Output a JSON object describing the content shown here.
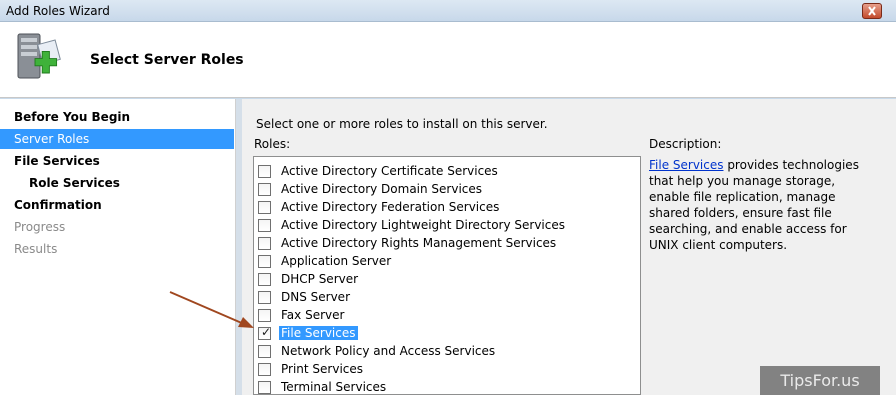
{
  "window": {
    "title": "Add Roles Wizard"
  },
  "header": {
    "title": "Select Server Roles",
    "icon": "server-add-icon"
  },
  "nav": {
    "items": [
      {
        "label": "Before You Begin",
        "state": "normal"
      },
      {
        "label": "Server Roles",
        "state": "selected"
      },
      {
        "label": "File Services",
        "state": "normal"
      },
      {
        "label": "Role Services",
        "state": "sub"
      },
      {
        "label": "Confirmation",
        "state": "normal"
      },
      {
        "label": "Progress",
        "state": "disabled"
      },
      {
        "label": "Results",
        "state": "disabled"
      }
    ]
  },
  "main": {
    "instruction": "Select one or more roles to install on this server.",
    "roles_label": "Roles:",
    "roles": [
      {
        "label": "Active Directory Certificate Services",
        "checked": false
      },
      {
        "label": "Active Directory Domain Services",
        "checked": false
      },
      {
        "label": "Active Directory Federation Services",
        "checked": false
      },
      {
        "label": "Active Directory Lightweight Directory Services",
        "checked": false
      },
      {
        "label": "Active Directory Rights Management Services",
        "checked": false
      },
      {
        "label": "Application Server",
        "checked": false
      },
      {
        "label": "DHCP Server",
        "checked": false
      },
      {
        "label": "DNS Server",
        "checked": false
      },
      {
        "label": "Fax Server",
        "checked": false
      },
      {
        "label": "File Services",
        "checked": true,
        "highlighted": true
      },
      {
        "label": "Network Policy and Access Services",
        "checked": false
      },
      {
        "label": "Print Services",
        "checked": false
      },
      {
        "label": "Terminal Services",
        "checked": false
      }
    ],
    "description_label": "Description:",
    "description_link": "File Services",
    "description_text": " provides technologies that help you manage storage, enable file replication, manage shared folders, ensure fast file searching, and enable access for UNIX client computers."
  },
  "watermark": "TipsFor.us",
  "colors": {
    "selection": "#3399ff",
    "link": "#0033cc",
    "arrow": "#a0471f"
  }
}
